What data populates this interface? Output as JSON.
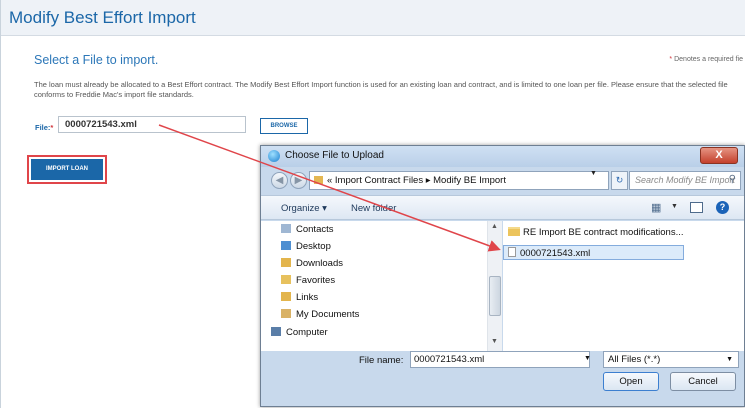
{
  "page": {
    "header_title": "Modify Best Effort Import",
    "subtitle": "Select a File to import.",
    "required_note_star": "*",
    "required_note": "Denotes a required fie",
    "intro_text": "The loan must already be allocated to a Best Effort contract. The Modify Best Effort Import function is used for an existing loan and contract, and is limited to one loan per file. Please ensure that the selected file conforms to Freddie Mac's import file standards.",
    "file_label": "File:",
    "file_label_star": "*",
    "file_value": "0000721543.xml",
    "browse_label": "BROWSE",
    "import_label": "IMPORT LOAN"
  },
  "dialog": {
    "title": "Choose File to Upload",
    "close_label": "X",
    "breadcrumb": "« Import Contract Files ▸ Modify BE Import",
    "search_placeholder": "Search Modify BE Import",
    "organize_label": "Organize ▾",
    "new_folder_label": "New folder",
    "nav_items": [
      "Contacts",
      "Desktop",
      "Downloads",
      "Favorites",
      "Links",
      "My Documents",
      "Computer"
    ],
    "folder_item": "RE Import BE contract modifications...",
    "file_item": "0000721543.xml",
    "file_name_label": "File name:",
    "file_name_value": "0000721543.xml",
    "file_type": "All Files (*.*)",
    "open_label": "Open",
    "cancel_label": "Cancel"
  },
  "colors": {
    "brand_blue": "#1b67a8",
    "highlight_red": "#e0454a",
    "selection_blue": "#dcebfa"
  }
}
